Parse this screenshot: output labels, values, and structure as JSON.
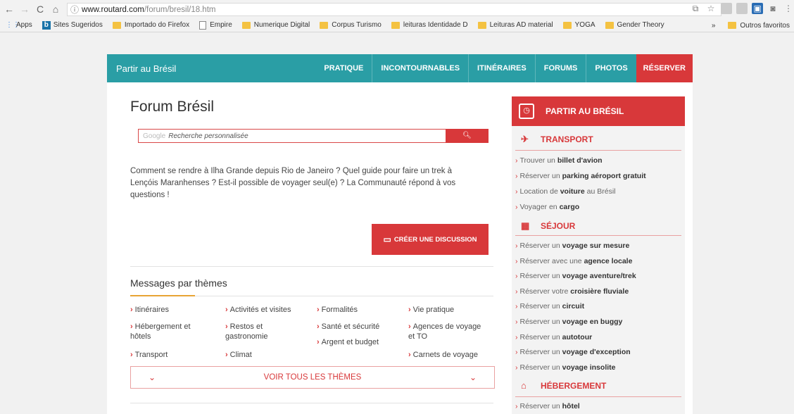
{
  "browser": {
    "url_host": "www.routard.com",
    "url_path": "/forum/bresil/18.htm",
    "bookmarks": [
      "Apps",
      "Sites Sugeridos",
      "Importado do Firefox",
      "Empire",
      "Numerique Digital",
      "Corpus Turismo",
      "leituras Identidade D",
      "Leituras AD material",
      "YOGA",
      "Gender Theory"
    ],
    "bookmarks_more": "»",
    "bookmarks_other": "Outros favoritos"
  },
  "nav": {
    "brand": "Partir au Brésil",
    "items": [
      "PRATIQUE",
      "INCONTOURNABLES",
      "ITINÉRAIRES",
      "FORUMS",
      "PHOTOS",
      "RÉSERVER"
    ]
  },
  "main": {
    "title": "Forum Brésil",
    "search_google": "Google",
    "search_placeholder": "Recherche personnalisée",
    "search_icon": "magnifier",
    "intro_1": "Comment se rendre à Ilha Grande depuis Rio de Janeiro ? Quel guide pour faire un trek à",
    "intro_2": "Lençóis Maranhenses ? Est-il possible de voyager seul(e) ? La Communauté répond à vos",
    "intro_3": "questions !",
    "create_label": "CRÉER UNE DISCUSSION",
    "messages_title": "Messages par thèmes",
    "themes": {
      "c1": [
        "Itinéraires",
        "Hébergement et",
        "hôtels",
        "Transport"
      ],
      "c2": [
        "Activités et visites",
        "Restos et",
        "gastronomie",
        "Climat"
      ],
      "c3": [
        "Formalités",
        "Santé et sécurité",
        "Argent et budget"
      ],
      "c4": [
        "Vie pratique",
        "Agences de voyage",
        "et TO",
        "Carnets de voyage"
      ]
    },
    "voir_label": "VOIR TOUS LES THÈMES"
  },
  "sidebar": {
    "header": "PARTIR AU BRÉSIL",
    "sections": {
      "transport": "TRANSPORT",
      "sejour": "SÉJOUR",
      "hebergement": "HÉBERGEMENT"
    },
    "transport_links": [
      {
        "pre": "Trouver un",
        "bold": "billet d'avion",
        "post": ""
      },
      {
        "pre": "Réserver un",
        "bold": "parking aéroport gratuit",
        "post": ""
      },
      {
        "pre": "Location de",
        "bold": "voiture",
        "post": "au Brésil"
      },
      {
        "pre": "Voyager en",
        "bold": "cargo",
        "post": ""
      }
    ],
    "sejour_links": [
      {
        "pre": "Réserver un",
        "bold": "voyage sur mesure"
      },
      {
        "pre": "Réserver avec une",
        "bold": "agence locale"
      },
      {
        "pre": "Réserver un",
        "bold": "voyage aventure/trek"
      },
      {
        "pre": "Réserver votre",
        "bold": "croisière fluviale"
      },
      {
        "pre": "Réserver un",
        "bold": "circuit"
      },
      {
        "pre": "Réserver un",
        "bold": "voyage en buggy"
      },
      {
        "pre": "Réserver un",
        "bold": "autotour"
      },
      {
        "pre": "Réserver un",
        "bold": "voyage d'exception"
      },
      {
        "pre": "Réserver un",
        "bold": "voyage insolite"
      }
    ],
    "hebergement_links": [
      {
        "pre": "Réserver un",
        "bold": "hôtel"
      }
    ]
  },
  "colors": {
    "teal": "#2a9ea5",
    "red": "#d8383a",
    "orange": "#e8a435"
  }
}
